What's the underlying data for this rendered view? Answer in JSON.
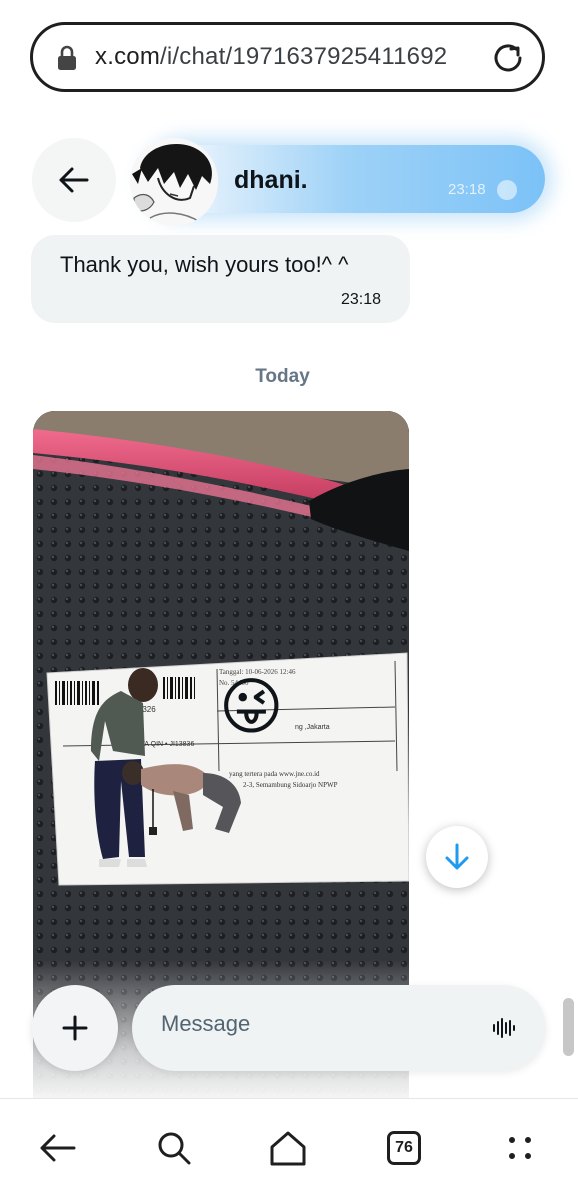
{
  "browser": {
    "url_domain": "x.com",
    "url_path": "/i/chat/1971637925411692",
    "tabs_count": "76"
  },
  "header": {
    "contact_name": "dhani.",
    "ghost_time": "23:18"
  },
  "messages": [
    {
      "text": "Thank you, wish yours too!^ ^",
      "time": "23:18",
      "direction": "received"
    }
  ],
  "day_separator": "Today",
  "image_message": {
    "receipt_date": "Tanggal: 10-06-2026 12:46",
    "receipt_no": "No.       54400",
    "receipt_barcode_no": "355326",
    "receipt_recipient": "ANITA QIN • JI13836",
    "receipt_city": "ng ,Jakarta",
    "receipt_footer_1": "yang tertera pada www.jne.co.id",
    "receipt_footer_2": "2-3, Semambung Sidoarjo NPWP",
    "emoji": "😜"
  },
  "composer": {
    "placeholder": "Message"
  },
  "icons": {
    "lock": "lock-icon",
    "reload": "reload-icon",
    "back": "back-arrow-icon",
    "scroll_down": "arrow-down-icon",
    "plus": "plus-icon",
    "voice": "voice-wave-icon",
    "nav_back": "nav-back-icon",
    "nav_search": "search-icon",
    "nav_home": "home-icon",
    "nav_menu": "menu-dots-icon"
  },
  "colors": {
    "accent": "#1d9bf0",
    "bubble": "#eff3f4",
    "muted": "#657786"
  }
}
